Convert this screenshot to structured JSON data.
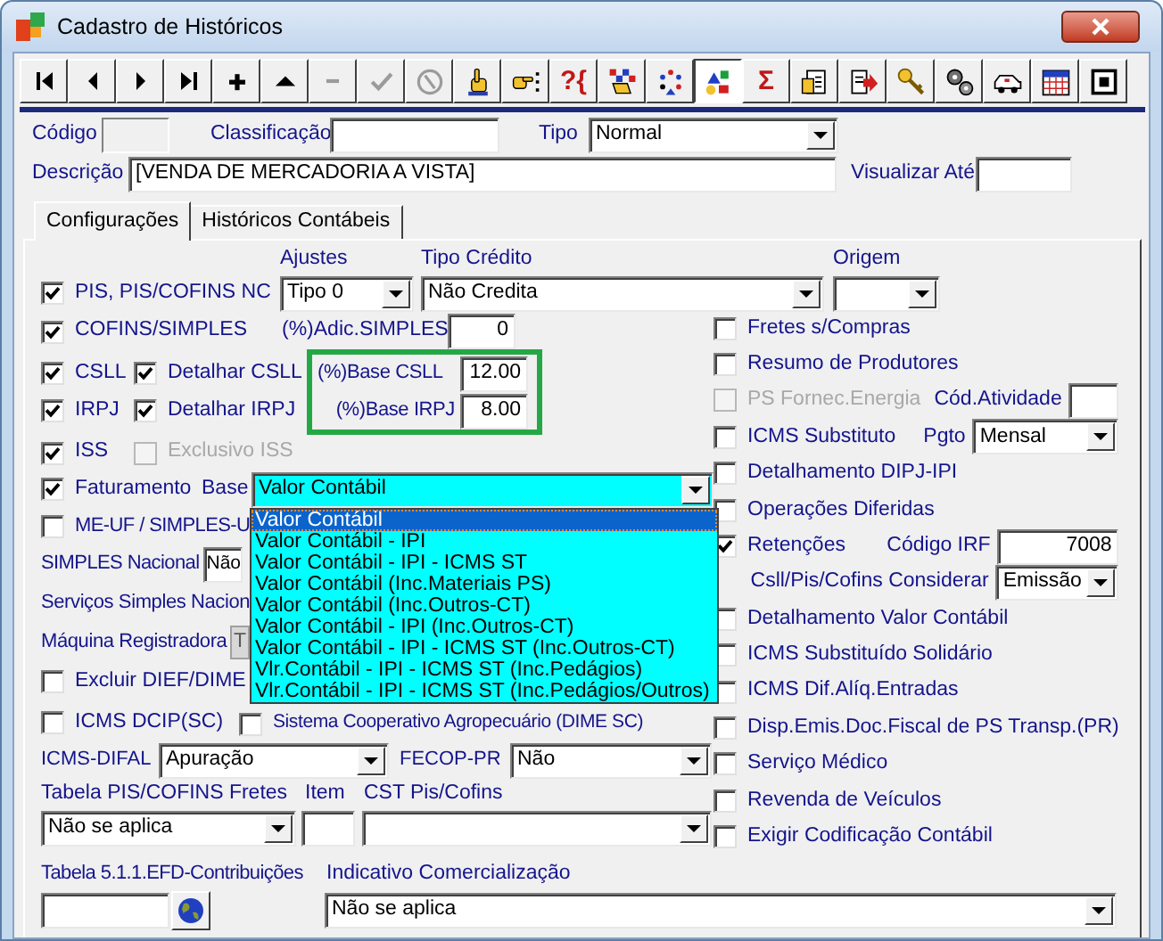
{
  "window": {
    "title": "Cadastro de Históricos"
  },
  "toolbar": [
    {
      "kind": "first",
      "disabled": false,
      "selected": false
    },
    {
      "kind": "previous",
      "disabled": false,
      "selected": false
    },
    {
      "kind": "next",
      "disabled": false,
      "selected": false
    },
    {
      "kind": "last",
      "disabled": false,
      "selected": false
    },
    {
      "kind": "plus",
      "disabled": false,
      "selected": false
    },
    {
      "kind": "up",
      "disabled": false,
      "selected": false
    },
    {
      "kind": "minus",
      "disabled": true,
      "selected": false
    },
    {
      "kind": "check",
      "disabled": true,
      "selected": false
    },
    {
      "kind": "circle",
      "disabled": true,
      "selected": false
    },
    {
      "kind": "hand",
      "disabled": false,
      "selected": false
    },
    {
      "kind": "pointing",
      "disabled": false,
      "selected": false
    },
    {
      "kind": "text",
      "label": "?{",
      "disabled": false,
      "selected": false
    },
    {
      "kind": "checker",
      "disabled": false,
      "selected": false
    },
    {
      "kind": "dots",
      "disabled": false,
      "selected": false
    },
    {
      "kind": "shapes",
      "disabled": false,
      "selected": true
    },
    {
      "kind": "text",
      "label": "Σ",
      "disabled": false,
      "selected": false
    },
    {
      "kind": "document",
      "disabled": false,
      "selected": false
    },
    {
      "kind": "export",
      "disabled": false,
      "selected": false
    },
    {
      "kind": "key",
      "disabled": false,
      "selected": false
    },
    {
      "kind": "gears",
      "disabled": false,
      "selected": false
    },
    {
      "kind": "car",
      "disabled": false,
      "selected": false
    },
    {
      "kind": "calendar",
      "disabled": false,
      "selected": false
    },
    {
      "kind": "stop",
      "disabled": false,
      "selected": false
    }
  ],
  "header": {
    "codigo": {
      "label": "Código"
    },
    "classificacao": {
      "label": "Classificação"
    },
    "tipo": {
      "label": "Tipo",
      "value": "Normal"
    },
    "descricao": {
      "label": "Descrição",
      "value": "[VENDA DE MERCADORIA A VISTA]"
    },
    "visualizar_ate": {
      "label": "Visualizar Até"
    }
  },
  "tabs": [
    {
      "label": "Configurações",
      "selected": true
    },
    {
      "label": "Históricos Contábeis",
      "selected": false
    }
  ],
  "config": {
    "ajustes": {
      "label": "Ajustes",
      "value": "Tipo 0"
    },
    "tipo_credito": {
      "label": "Tipo Crédito",
      "value": "Não Credita"
    },
    "origem": {
      "label": "Origem"
    },
    "pis": {
      "label": "PIS, PIS/COFINS NC",
      "checked": true
    },
    "cofins_simples": {
      "label": "COFINS/SIMPLES",
      "checked": true
    },
    "adic_simples": {
      "label": "(%)Adic.SIMPLES",
      "value": "0"
    },
    "csll": {
      "label": "CSLL",
      "checked": true
    },
    "detalhar_csll": {
      "label": "Detalhar CSLL",
      "checked": true
    },
    "base_csll": {
      "label": "(%)Base CSLL",
      "value": "12.00"
    },
    "irpj": {
      "label": "IRPJ",
      "checked": true
    },
    "detalhar_irpj": {
      "label": "Detalhar IRPJ",
      "checked": true
    },
    "base_irpj": {
      "label": "(%)Base IRPJ",
      "value": "8.00"
    },
    "iss": {
      "label": "ISS",
      "checked": true
    },
    "exclusivo_iss": {
      "label": "Exclusivo ISS",
      "checked": false,
      "disabled": true
    },
    "faturamento": {
      "label": "Faturamento",
      "checked": true
    },
    "base": {
      "label": "Base",
      "value": "Valor Contábil",
      "expanded": true,
      "options": [
        {
          "label": "Valor Contábil",
          "selected": true
        },
        {
          "label": "Valor Contábil - IPI",
          "selected": false
        },
        {
          "label": "Valor Contábil - IPI - ICMS ST",
          "selected": false
        },
        {
          "label": "Valor Contábil (Inc.Materiais PS)",
          "selected": false
        },
        {
          "label": "Valor Contábil  (Inc.Outros-CT)",
          "selected": false
        },
        {
          "label": "Valor Contábil - IPI (Inc.Outros-CT)",
          "selected": false
        },
        {
          "label": "Valor Contábil - IPI - ICMS ST (Inc.Outros-CT)",
          "selected": false
        },
        {
          "label": "Vlr.Contábil - IPI - ICMS ST (Inc.Pedágios)",
          "selected": false
        },
        {
          "label": "Vlr.Contábil - IPI - ICMS ST (Inc.Pedágios/Outros)",
          "selected": false
        }
      ]
    },
    "me_uf": {
      "label": "ME-UF / SIMPLES-U",
      "checked": false
    },
    "simples_nacional": {
      "label": "SIMPLES Nacional",
      "value": "Não"
    },
    "servicos_simples": {
      "label": "Serviços Simples Nacion"
    },
    "maquina_registradora": {
      "label": "Máquina Registradora",
      "value": "T"
    },
    "excluir_dief": {
      "label": "Excluir DIEF/DIME",
      "checked": false
    },
    "icms_dcip": {
      "label": "ICMS DCIP(SC)",
      "checked": false
    },
    "sistema_cooperativo": {
      "label": "Sistema Cooperativo Agropecuário (DIME SC)",
      "checked": false
    },
    "icms_difal": {
      "label": "ICMS-DIFAL",
      "value": "Apuração"
    },
    "fecop_pr": {
      "label": "FECOP-PR",
      "value": "Não"
    },
    "tabela_pis": {
      "label": "Tabela PIS/COFINS Fretes",
      "value": "Não se aplica"
    },
    "item": {
      "label": "Item"
    },
    "cst": {
      "label": "CST Pis/Cofins"
    },
    "tabela_511": {
      "label": "Tabela 5.1.1.EFD-Contribuições"
    },
    "indicativo": {
      "label": "Indicativo Comercialização",
      "value": "Não se aplica"
    },
    "right_options": [
      {
        "kind": "checkbox",
        "label": "Fretes s/Compras",
        "checked": false
      },
      {
        "kind": "checkbox",
        "label": "Resumo de Produtores",
        "checked": false
      },
      {
        "kind": "checkbox",
        "label": "PS Fornec.Energia",
        "checked": false,
        "disabled": true,
        "extra": {
          "kind": "field",
          "label": "Cód.Atividade"
        }
      },
      {
        "kind": "checkbox",
        "label": "ICMS Substituto",
        "checked": false,
        "extra": {
          "kind": "combo",
          "label": "Pgto",
          "value": "Mensal"
        }
      },
      {
        "kind": "checkbox",
        "label": "Detalhamento DIPJ-IPI",
        "checked": false
      },
      {
        "kind": "checkbox",
        "label": "Operações Diferidas",
        "checked": false
      },
      {
        "kind": "checkbox",
        "label": "Retenções",
        "checked": true,
        "extra": {
          "kind": "field",
          "label": "Código IRF",
          "value": "7008"
        }
      },
      {
        "kind": "combo",
        "label": "Csll/Pis/Cofins Considerar",
        "value": "Emissão"
      },
      {
        "kind": "checkbox",
        "label": "Detalhamento Valor Contábil",
        "checked": false
      },
      {
        "kind": "checkbox",
        "label": "ICMS Substituído Solidário",
        "checked": false
      },
      {
        "kind": "checkbox",
        "label": "ICMS Dif.Alíq.Entradas",
        "checked": false
      },
      {
        "kind": "checkbox",
        "label": "Disp.Emis.Doc.Fiscal de PS Transp.(PR)",
        "checked": false
      },
      {
        "kind": "checkbox",
        "label": "Serviço Médico",
        "checked": false
      },
      {
        "kind": "checkbox",
        "label": "Revenda de Veículos",
        "checked": false
      },
      {
        "kind": "checkbox",
        "label": "Exigir Codificação Contábil",
        "checked": false
      }
    ]
  }
}
